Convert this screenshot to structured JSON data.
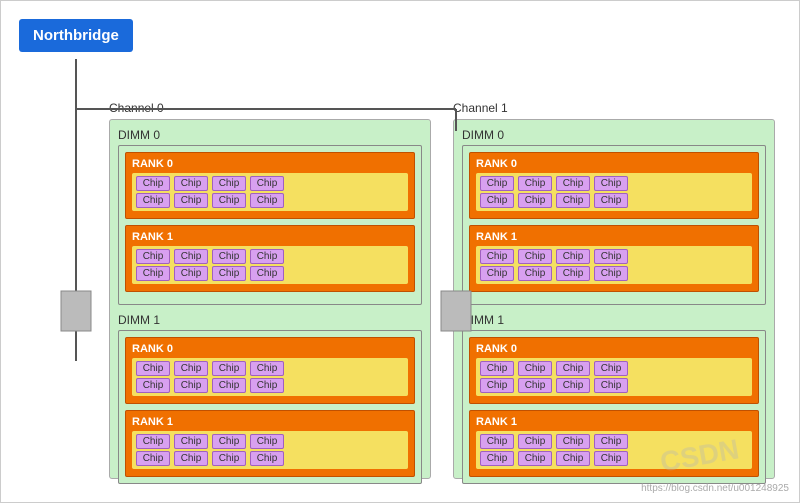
{
  "northbridge": {
    "label": "Northbridge"
  },
  "channels": [
    {
      "id": "channel0",
      "label": "Channel 0",
      "dimms": [
        {
          "id": "dimm0",
          "label": "DIMM 0",
          "ranks": [
            {
              "id": "rank0",
              "label": "RANK 0",
              "rows": [
                [
                  "Chip",
                  "Chip",
                  "Chip",
                  "Chip"
                ],
                [
                  "Chip",
                  "Chip",
                  "Chip",
                  "Chip"
                ]
              ]
            },
            {
              "id": "rank1",
              "label": "RANK 1",
              "rows": [
                [
                  "Chip",
                  "Chip",
                  "Chip",
                  "Chip"
                ],
                [
                  "Chip",
                  "Chip",
                  "Chip",
                  "Chip"
                ]
              ]
            }
          ]
        },
        {
          "id": "dimm1",
          "label": "DIMM 1",
          "ranks": [
            {
              "id": "rank0",
              "label": "RANK 0",
              "rows": [
                [
                  "Chip",
                  "Chip",
                  "Chip",
                  "Chip"
                ],
                [
                  "Chip",
                  "Chip",
                  "Chip",
                  "Chip"
                ]
              ]
            },
            {
              "id": "rank1",
              "label": "RANK 1",
              "rows": [
                [
                  "Chip",
                  "Chip",
                  "Chip",
                  "Chip"
                ],
                [
                  "Chip",
                  "Chip",
                  "Chip",
                  "Chip"
                ]
              ]
            }
          ]
        }
      ]
    },
    {
      "id": "channel1",
      "label": "Channel 1",
      "dimms": [
        {
          "id": "dimm0",
          "label": "DIMM 0",
          "ranks": [
            {
              "id": "rank0",
              "label": "RANK 0",
              "rows": [
                [
                  "Chip",
                  "Chip",
                  "Chip",
                  "Chip"
                ],
                [
                  "Chip",
                  "Chip",
                  "Chip",
                  "Chip"
                ]
              ]
            },
            {
              "id": "rank1",
              "label": "RANK 1",
              "rows": [
                [
                  "Chip",
                  "Chip",
                  "Chip",
                  "Chip"
                ],
                [
                  "Chip",
                  "Chip",
                  "Chip",
                  "Chip"
                ]
              ]
            }
          ]
        },
        {
          "id": "dimm1",
          "label": "DIMM 1",
          "ranks": [
            {
              "id": "rank0",
              "label": "RANK 0",
              "rows": [
                [
                  "Chip",
                  "Chip",
                  "Chip",
                  "Chip"
                ],
                [
                  "Chip",
                  "Chip",
                  "Chip",
                  "Chip"
                ]
              ]
            },
            {
              "id": "rank1",
              "label": "RANK 1",
              "rows": [
                [
                  "Chip",
                  "Chip",
                  "Chip",
                  "Chip"
                ],
                [
                  "Chip",
                  "Chip",
                  "Chip",
                  "Chip"
                ]
              ]
            }
          ]
        }
      ]
    }
  ],
  "watermark": "CSDN",
  "url": "https://blog.csdn.net/u001248925"
}
